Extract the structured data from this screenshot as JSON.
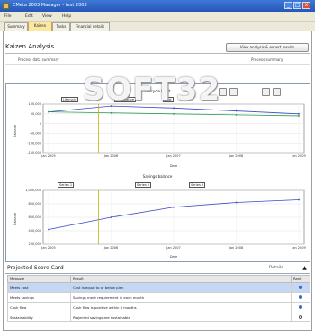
{
  "window": {
    "title": "CMeta 2003 Manager - test 2003",
    "minimize_label": "_",
    "maximize_label": "□",
    "close_label": "x"
  },
  "menu": [
    "File",
    "Edit",
    "View",
    "Help"
  ],
  "tabs": [
    {
      "label": "Summary",
      "active": false
    },
    {
      "label": "Kaizen",
      "active": true
    },
    {
      "label": "Tasks",
      "active": false
    },
    {
      "label": "Financial details",
      "active": false
    }
  ],
  "header": {
    "title": "Kaizen Analysis",
    "run_button": "View analysis & export results",
    "left_caption": "Process data summary",
    "right_caption": "Process summary"
  },
  "chart1": {
    "title": "Lifecycle Profit",
    "legend": [
      "Lifecycle",
      "Cumulative",
      "Cost"
    ],
    "ylabel": "Balance",
    "xlabel": "Date",
    "xticks": [
      "Jan 2005",
      "Jan 2006",
      "Jan 2007",
      "Jan 2008",
      "Jan 2009"
    ],
    "yticks": [
      "100,000",
      "50,000",
      "0",
      "-50,000",
      "-100,000",
      "-150,000"
    ]
  },
  "chart2": {
    "title": "Savings balance",
    "legend": [
      "Series 1",
      "Series 2",
      "Series 3"
    ],
    "ylabel": "Balance",
    "xlabel": "Date",
    "xticks": [
      "Jan 2005",
      "Jan 2006",
      "Jan 2007",
      "Jan 2008",
      "Jan 2009"
    ],
    "yticks": [
      "1,000,000",
      "800,000",
      "600,000",
      "400,000",
      "200,000"
    ]
  },
  "chart_data": [
    {
      "type": "line",
      "title": "Lifecycle Profit",
      "xlabel": "Date",
      "ylabel": "Balance",
      "x": [
        "Jan 2005",
        "Jan 2006",
        "Jan 2007",
        "Jan 2008",
        "Jan 2009"
      ],
      "ylim": [
        -150000,
        100000
      ],
      "series": [
        {
          "values": [
            60000,
            90000,
            80000,
            65000,
            50000
          ]
        },
        {
          "values": [
            60000,
            55000,
            50000,
            45000,
            40000
          ]
        }
      ]
    },
    {
      "type": "line",
      "title": "Savings balance",
      "xlabel": "Date",
      "ylabel": "Balance",
      "x": [
        "Jan 2005",
        "Jan 2006",
        "Jan 2007",
        "Jan 2008",
        "Jan 2009"
      ],
      "ylim": [
        200000,
        1000000
      ],
      "series": [
        {
          "values": [
            420000,
            600000,
            750000,
            820000,
            860000
          ]
        }
      ]
    }
  ],
  "scorecard": {
    "title": "Projected Score Card",
    "right_label": "Details",
    "columns": [
      "Measure",
      "Result",
      "Rank"
    ],
    "rows": [
      {
        "measure": "Meets cost",
        "result": "Cost is equal to or below plan",
        "selected": true
      },
      {
        "measure": "Meets savings",
        "result": "Savings meet requirement in each month",
        "selected": false
      },
      {
        "measure": "Cash flow",
        "result": "Cash flow is positive within 6 months",
        "selected": false
      },
      {
        "measure": "Sustainability",
        "result": "Projected savings are sustainable",
        "selected": false
      }
    ]
  },
  "watermark": "SOFT32"
}
